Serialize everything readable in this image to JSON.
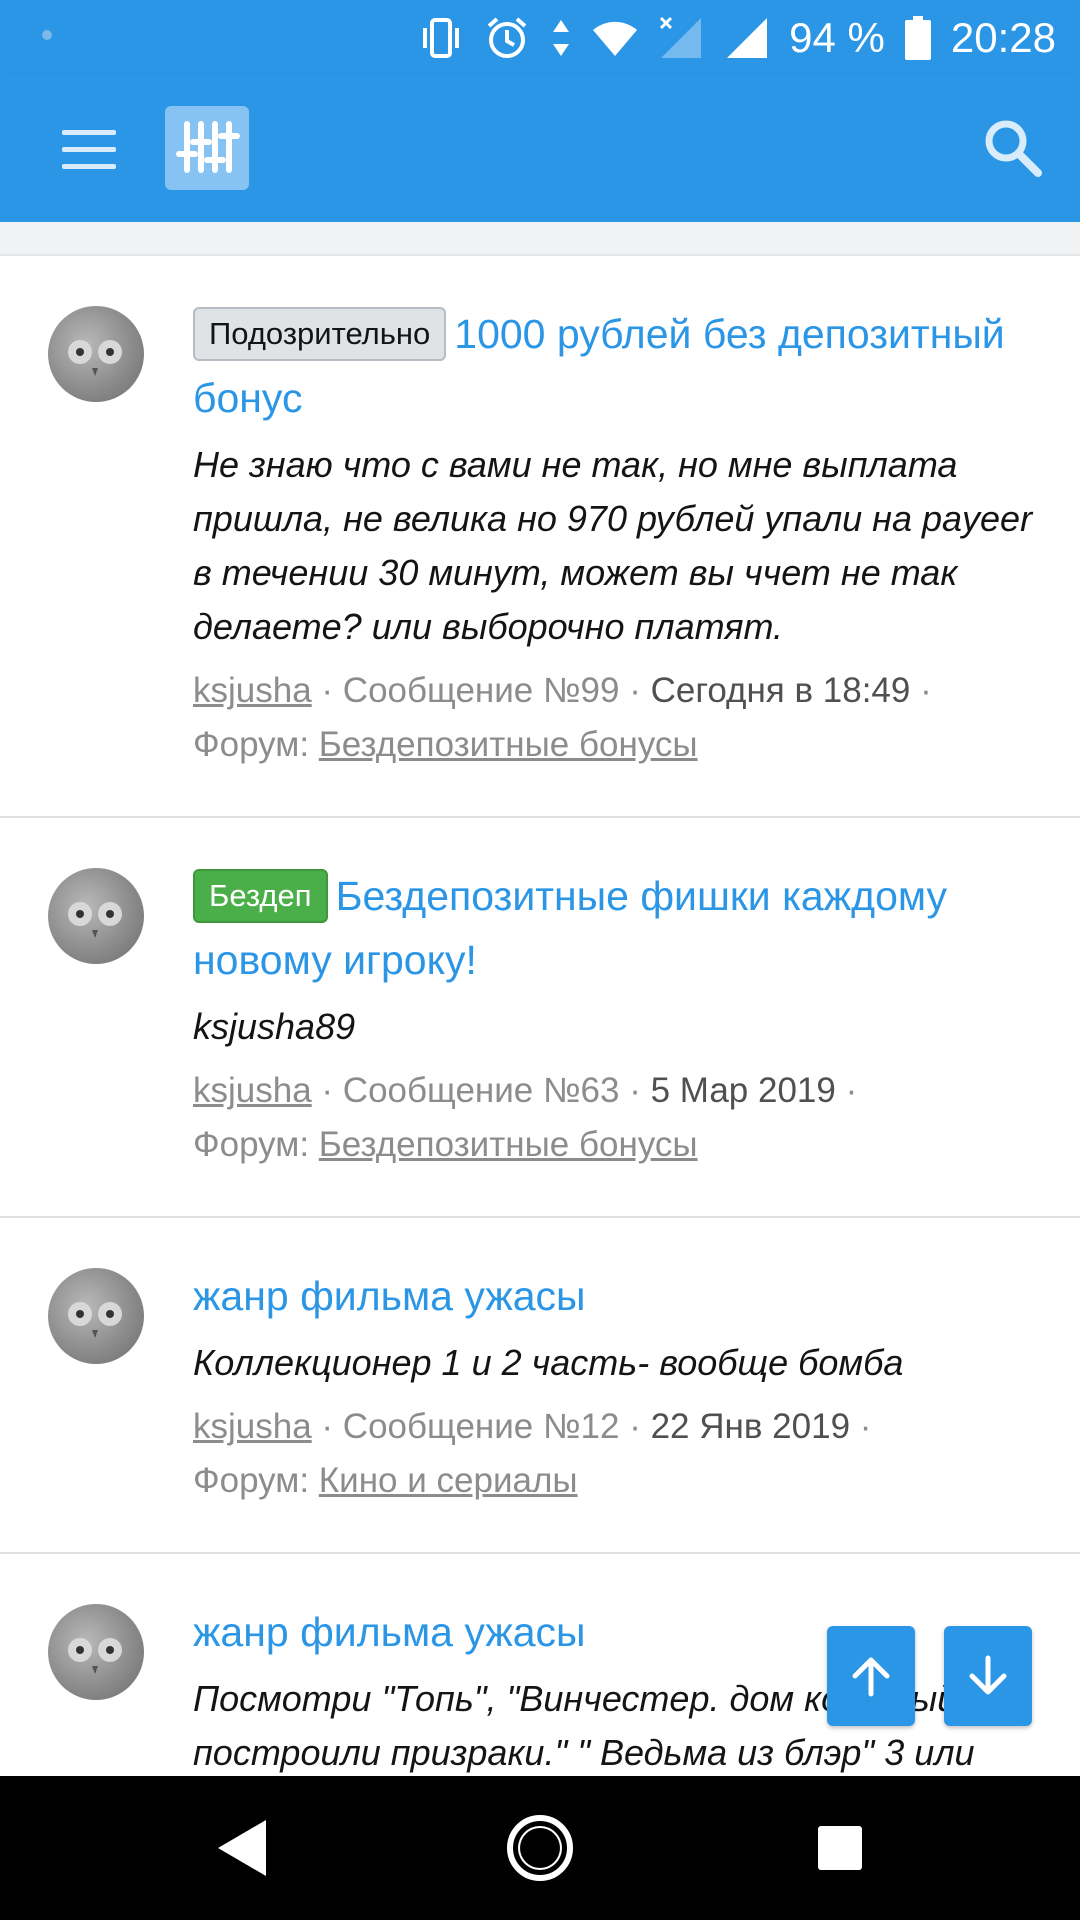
{
  "status_bar": {
    "battery": "94 %",
    "time": "20:28",
    "icons": [
      "vibrate-icon",
      "alarm-icon",
      "data-arrows-icon",
      "wifi-icon",
      "signal-off-icon",
      "signal-icon",
      "battery-icon"
    ]
  },
  "app_bar": {
    "icons": [
      "menu-icon",
      "filter-sliders-icon",
      "search-icon"
    ]
  },
  "colors": {
    "primary": "#2b95e6",
    "label_gray": "#dfe3e6",
    "label_green": "#4aaf49",
    "meta_text": "#8c8c8c"
  },
  "results": [
    {
      "label": "Подозрительно",
      "title": "1000 рублей без депозитный бонус",
      "snippet": "Не знаю что с вами не так, но мне выплата пришла, не велика но 970 рублей упали на payeer в течении 30 минут, может вы ччет не так делаете? или выборочно платят.",
      "user": "ksjusha",
      "message": "Сообщение №99",
      "date": "Сегодня в 18:49",
      "forum_prefix": "Форум:",
      "forum": "Бездепозитные бонусы"
    },
    {
      "label": "Бездеп",
      "title": "Бездепозитные фишки каждому новому игроку!",
      "snippet": "ksjusha89",
      "user": "ksjusha",
      "message": "Сообщение №63",
      "date": "5 Мар 2019",
      "forum_prefix": "Форум:",
      "forum": "Бездепозитные бонусы"
    },
    {
      "title": "жанр фильма ужасы",
      "snippet": "Коллекционер 1 и 2 часть- вообще бомба",
      "user": "ksjusha",
      "message": "Сообщение №12",
      "date": "22 Янв 2019",
      "forum_prefix": "Форум:",
      "forum": "Кино и сериалы"
    },
    {
      "title": "жанр фильма ужасы",
      "snippet": "Посмотри \"Топь\", \"Винчестер. дом который построили призраки.\" \" Ведьма из блэр\" 3 или"
    }
  ],
  "float_buttons": [
    "arrow-up-icon",
    "arrow-down-icon"
  ],
  "nav_bar": [
    "back-icon",
    "home-icon",
    "recents-icon"
  ]
}
